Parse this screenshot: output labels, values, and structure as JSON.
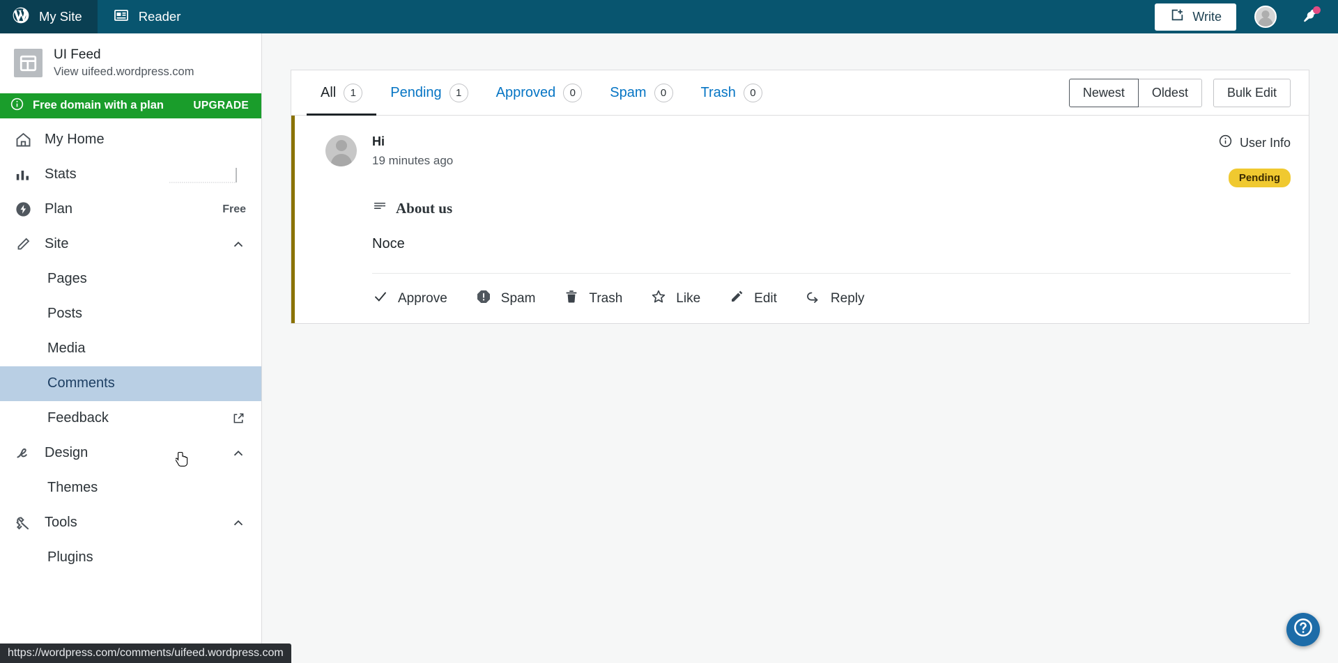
{
  "masterbar": {
    "my_site_label": "My Site",
    "my_site_icon": "wordpress-logo-icon",
    "reader_label": "Reader",
    "reader_icon": "reader-icon",
    "write_label": "Write",
    "write_icon": "write-new-post-icon",
    "avatar_icon": "user-avatar",
    "notifications_icon": "notifications-bell-icon",
    "notifications_has_unread": true,
    "background_color": "#08556f",
    "my_site_background_color": "#0a3f52"
  },
  "sidebar": {
    "site": {
      "title": "UI Feed",
      "url_label": "View uifeed.wordpress.com",
      "thumb_icon": "site-layout-icon"
    },
    "upgrade_banner": {
      "icon": "info-circle-icon",
      "text": "Free domain with a plan",
      "cta": "UPGRADE",
      "color": "#1a9d2b"
    },
    "items": [
      {
        "label": "My Home",
        "icon": "home-icon",
        "meta": "",
        "expandable": false
      },
      {
        "label": "Stats",
        "icon": "stats-bars-icon",
        "meta": "",
        "expandable": false,
        "sparkline": true
      },
      {
        "label": "Plan",
        "icon": "plan-bolt-icon",
        "meta": "Free",
        "expandable": false
      },
      {
        "label": "Site",
        "icon": "pencil-icon",
        "meta": "",
        "expandable": true,
        "expanded": true
      },
      {
        "label": "Design",
        "icon": "design-brush-icon",
        "meta": "",
        "expandable": true,
        "expanded": true
      },
      {
        "label": "Tools",
        "icon": "wrench-icon",
        "meta": "",
        "expandable": true,
        "expanded": true
      }
    ],
    "site_sub_items": [
      {
        "label": "Pages",
        "selected": false,
        "external": false
      },
      {
        "label": "Posts",
        "selected": false,
        "external": false
      },
      {
        "label": "Media",
        "selected": false,
        "external": false
      },
      {
        "label": "Comments",
        "selected": true,
        "external": false
      },
      {
        "label": "Feedback",
        "selected": false,
        "external": true,
        "external_icon": "external-link-icon"
      }
    ],
    "design_sub_items": [
      {
        "label": "Themes",
        "selected": false,
        "external": false
      }
    ],
    "tools_sub_items": [
      {
        "label": "Plugins",
        "selected": false,
        "external": false
      }
    ],
    "selected_highlight_color": "#b9cfe4"
  },
  "toolbar": {
    "tabs": [
      {
        "label": "All",
        "count": "1",
        "active": true
      },
      {
        "label": "Pending",
        "count": "1",
        "active": false
      },
      {
        "label": "Approved",
        "count": "0",
        "active": false
      },
      {
        "label": "Spam",
        "count": "0",
        "active": false
      },
      {
        "label": "Trash",
        "count": "0",
        "active": false
      }
    ],
    "sort": {
      "newest_label": "Newest",
      "oldest_label": "Oldest",
      "selected": "Newest"
    },
    "bulk_edit_label": "Bulk Edit"
  },
  "comment": {
    "author": "Hi",
    "timestamp": "19 minutes ago",
    "avatar_icon": "user-avatar",
    "user_info_label": "User Info",
    "user_info_icon": "info-circle-icon",
    "status_badge": "Pending",
    "status_badge_color": "#f0c930",
    "accent_border_color": "#8a7200",
    "post_title": "About us",
    "post_icon": "post-lines-icon",
    "body": "Noce",
    "actions": [
      {
        "label": "Approve",
        "icon": "checkmark-icon"
      },
      {
        "label": "Spam",
        "icon": "spam-octagon-icon"
      },
      {
        "label": "Trash",
        "icon": "trash-icon"
      },
      {
        "label": "Like",
        "icon": "star-icon"
      },
      {
        "label": "Edit",
        "icon": "pencil-icon"
      },
      {
        "label": "Reply",
        "icon": "reply-arrow-icon"
      }
    ]
  },
  "help": {
    "icon": "help-question-icon",
    "color": "#1d6ca8"
  },
  "statusbar": {
    "url": "https://wordpress.com/comments/uifeed.wordpress.com"
  }
}
